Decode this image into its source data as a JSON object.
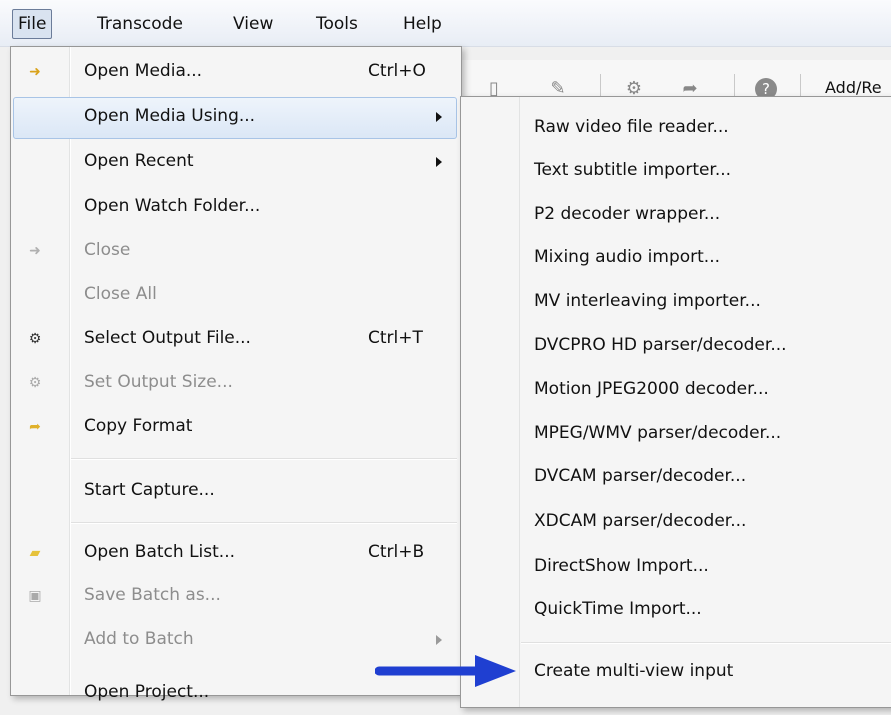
{
  "menubar": {
    "items": [
      {
        "label": "File"
      },
      {
        "label": "Transcode"
      },
      {
        "label": "View"
      },
      {
        "label": "Tools"
      },
      {
        "label": "Help"
      }
    ]
  },
  "toolbar": {
    "add_label": "Add/Re"
  },
  "file_menu": {
    "items": [
      {
        "label": "Open Media...",
        "shortcut": "Ctrl+O"
      },
      {
        "label": "Open Media Using..."
      },
      {
        "label": "Open Recent"
      },
      {
        "label": "Open Watch Folder..."
      },
      {
        "label": "Close"
      },
      {
        "label": "Close All"
      },
      {
        "label": "Select Output File...",
        "shortcut": "Ctrl+T"
      },
      {
        "label": "Set Output Size..."
      },
      {
        "label": "Copy Format"
      },
      {
        "label": "Start Capture..."
      },
      {
        "label": "Open Batch List...",
        "shortcut": "Ctrl+B"
      },
      {
        "label": "Save Batch as..."
      },
      {
        "label": "Add to Batch"
      },
      {
        "label": "Open Project..."
      }
    ]
  },
  "submenu": {
    "items": [
      {
        "label": "Raw video file reader..."
      },
      {
        "label": "Text subtitle importer..."
      },
      {
        "label": "P2 decoder wrapper..."
      },
      {
        "label": "Mixing audio import..."
      },
      {
        "label": "MV interleaving importer..."
      },
      {
        "label": "DVCPRO HD parser/decoder..."
      },
      {
        "label": "Motion JPEG2000 decoder..."
      },
      {
        "label": "MPEG/WMV parser/decoder..."
      },
      {
        "label": "DVCAM parser/decoder..."
      },
      {
        "label": "XDCAM parser/decoder..."
      },
      {
        "label": "DirectShow Import..."
      },
      {
        "label": "QuickTime Import..."
      },
      {
        "label": "Create multi-view input"
      }
    ]
  },
  "colors": {
    "highlight": "#dbe7f6",
    "annotation_arrow": "#1f3fd1"
  }
}
